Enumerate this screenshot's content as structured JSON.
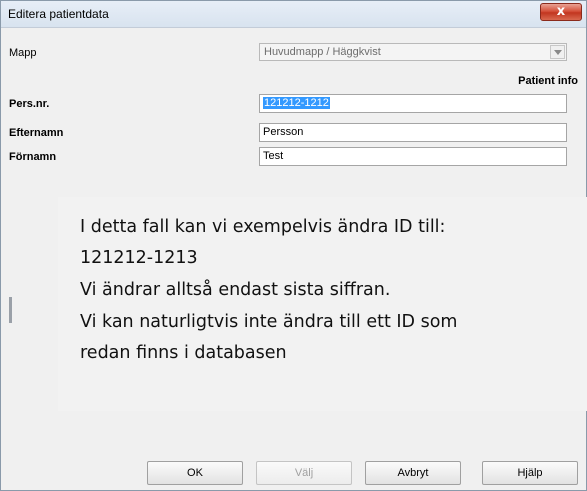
{
  "window": {
    "title": "Editera  patientdata",
    "close_glyph": "x"
  },
  "form": {
    "mapp": {
      "label": "Mapp",
      "value": "Huvudmapp / Häggkvist"
    },
    "section_header": "Patient info",
    "fields": [
      {
        "label": "Pers.nr.",
        "value": "121212-1212",
        "selected": true
      },
      {
        "label": "Efternamn",
        "value": "Persson"
      },
      {
        "label": "Förnamn",
        "value": "Test"
      }
    ]
  },
  "callout": {
    "lines": [
      "I detta fall kan vi exempelvis ändra ID till:",
      "121212-1213",
      "Vi ändrar alltså endast sista siffran.",
      "Vi kan naturligtvis inte ändra till ett ID som",
      "redan finns i databasen"
    ]
  },
  "buttons": {
    "ok": "OK",
    "valj": "Välj",
    "avbryt": "Avbryt",
    "hjalp": "Hjälp"
  },
  "icons": {
    "close": "close-icon",
    "dropdown": "chevron-down-icon"
  },
  "colors": {
    "close_button": "#c8412b",
    "selection": "#3399ff",
    "dialog_background": "#f0f0f0"
  }
}
